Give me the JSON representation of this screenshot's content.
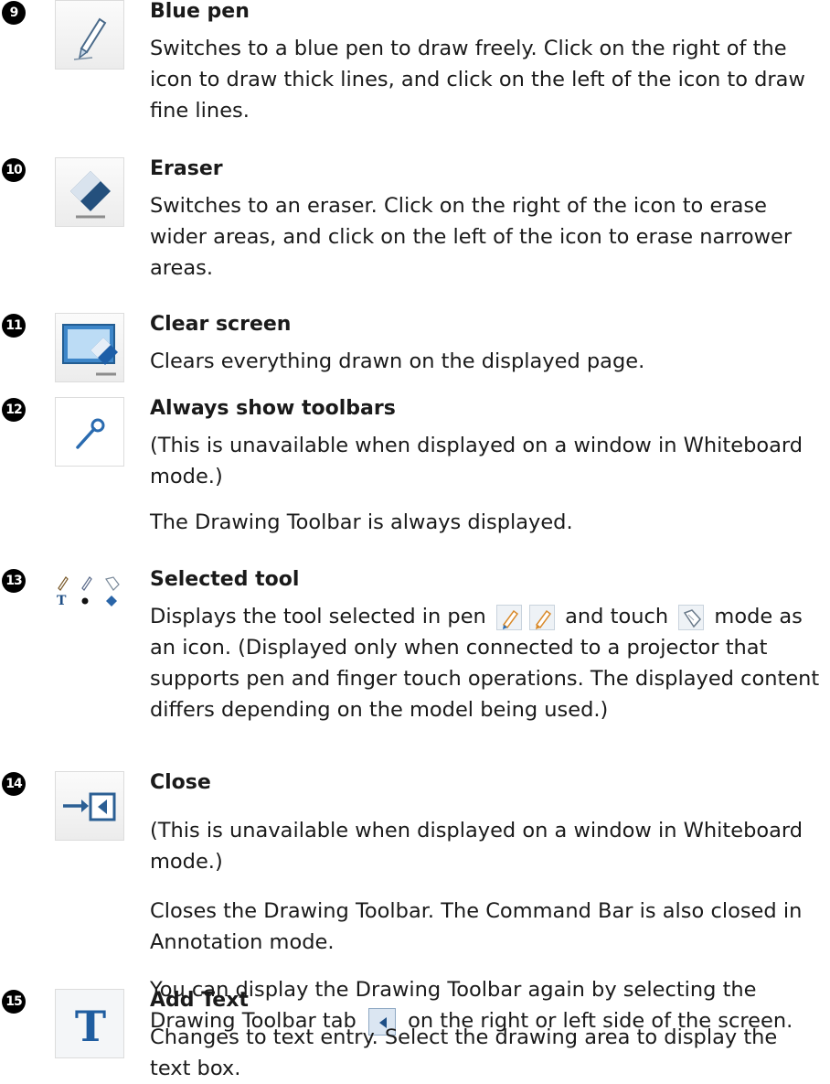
{
  "entries": [
    {
      "number": "9",
      "icon": "blue-pen-icon",
      "title": "Blue pen",
      "body": [
        "Switches to a blue pen to draw freely. Click on the right of the icon to draw thick lines, and click on the left of the icon to draw fine lines."
      ]
    },
    {
      "number": "10",
      "icon": "eraser-icon",
      "title": "Eraser",
      "body": [
        "Switches to an eraser. Click on the right of the icon to erase wider areas, and click on the left of the icon to erase narrower areas."
      ]
    },
    {
      "number": "11",
      "icon": "clear-screen-icon",
      "title": "Clear screen",
      "body": [
        "Clears everything drawn on the displayed page."
      ]
    },
    {
      "number": "12",
      "icon": "pushpin-icon",
      "title": "Always show toolbars",
      "body": [
        "(This is unavailable when displayed on a window in Whiteboard mode.)",
        "The Drawing Toolbar is always displayed."
      ]
    },
    {
      "number": "13",
      "icon": "selected-tool-icon",
      "title": "Selected tool",
      "body_parts": {
        "before_icons": "Displays the tool selected in pen",
        "middle": "and touch",
        "after": "mode as an icon. (Displayed only when connected to a projector that supports pen and finger touch operations. The displayed content differs depending on the model being used.)"
      }
    },
    {
      "number": "14",
      "icon": "close-toolbar-icon",
      "title": "Close",
      "body": [
        "(This is unavailable when displayed on a window in Whiteboard mode.)",
        "Closes the Drawing Toolbar. The Command Bar is also closed in Annotation mode."
      ],
      "tab_note": {
        "before": "You can display the Drawing Toolbar again by selecting the Drawing Toolbar tab",
        "after": "on the right or left side of the screen."
      }
    },
    {
      "number": "15",
      "icon": "add-text-icon",
      "title": "Add Text",
      "icon_letter": "T",
      "body": [
        "Changes to text entry. Select the drawing area to display the text box."
      ]
    }
  ]
}
